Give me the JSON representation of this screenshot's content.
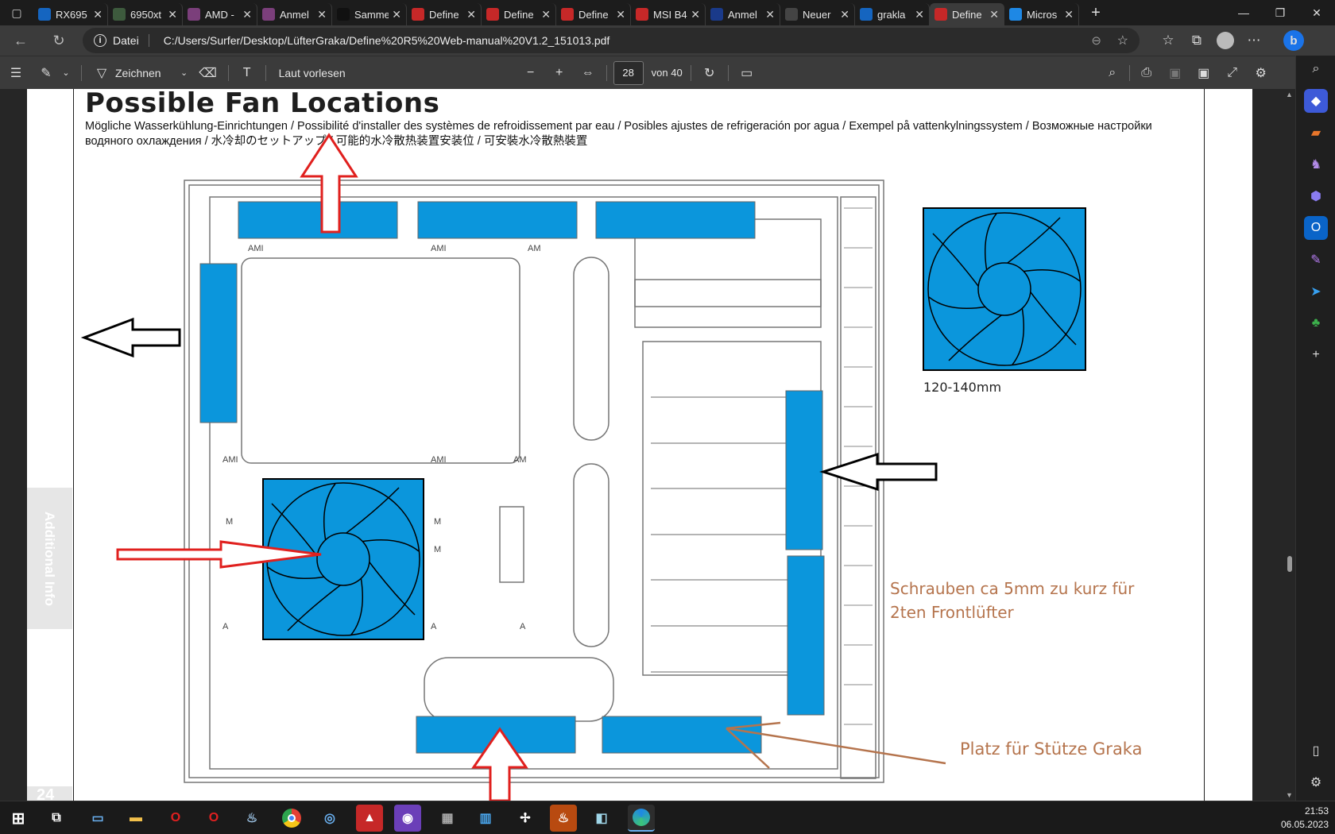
{
  "tabs": [
    {
      "label": "RX695",
      "color": "#1565c0",
      "icon": "browser-tab-icon"
    },
    {
      "label": "6950xt",
      "color": "#3d5a3d",
      "icon": "techpowerup-icon"
    },
    {
      "label": "AMD -",
      "color": "#7b3f7b",
      "icon": "amd-community-icon"
    },
    {
      "label": "Anmel",
      "color": "#7b3f7b",
      "icon": "amd-community-icon"
    },
    {
      "label": "Samme",
      "color": "#111111",
      "icon": "computerbase-icon"
    },
    {
      "label": "Define",
      "color": "#c62828",
      "icon": "pdf-icon"
    },
    {
      "label": "Define",
      "color": "#c62828",
      "icon": "pdf-icon"
    },
    {
      "label": "Define",
      "color": "#c62828",
      "icon": "pdf-icon"
    },
    {
      "label": "MSI B4",
      "color": "#c62828",
      "icon": "pdf-icon"
    },
    {
      "label": "Anmel",
      "color": "#1a3a8a",
      "icon": "forum-icon"
    },
    {
      "label": "Neuer",
      "color": "#444444",
      "icon": "newtab-icon"
    },
    {
      "label": "grakla",
      "color": "#1565c0",
      "icon": "browser-tab-icon"
    },
    {
      "label": "Define",
      "color": "#c62828",
      "icon": "pdf-icon",
      "active": true
    },
    {
      "label": "Micros",
      "color": "#1e88e5",
      "icon": "edge-icon"
    }
  ],
  "address": {
    "scheme_label": "Datei",
    "url": "C:/Users/Surfer/Desktop/LüfterGraka/Define%20R5%20Web-manual%20V1.2_151013.pdf"
  },
  "pdf_toolbar": {
    "draw_label": "Zeichnen",
    "read_aloud_label": "Laut vorlesen",
    "page_current": "28",
    "page_total_label": "von 40"
  },
  "page": {
    "title": "Possible Fan Locations",
    "subtitle": "Mögliche Wasserkühlung-Einrichtungen / Possibilité d'installer des systèmes de refroidissement par eau / Posibles ajustes de refrigeración por agua / Exempel på vattenkylningssystem / Возможные настройки водяного охлаждения / 水冷却のセットアップ / 可能的水冷散热装置安装位 / 可安裝水冷散熱裝置",
    "side_tab": "Additional Info",
    "page_number": "24",
    "fan_size_label": "120-140mm",
    "annotation_screws": "Schrauben ca 5mm zu kurz für 2ten Frontlüfter",
    "annotation_screws_line1": "Schrauben ca 5mm zu kurz für",
    "annotation_screws_line2": "2ten Frontlüfter",
    "annotation_support": "Platz für Stütze Graka",
    "case_labels": [
      "AMI",
      "AMI",
      "AM",
      "AMI",
      "AMI",
      "AM",
      "M",
      "M",
      "M",
      "A",
      "A",
      "A"
    ]
  },
  "clock": {
    "time": "21:53",
    "date": "06.05.2023"
  },
  "colors": {
    "fan_blue": "#0b96dc",
    "annotation": "#b5744d",
    "arrow_red": "#e0201e",
    "arrow_black": "#000000"
  }
}
